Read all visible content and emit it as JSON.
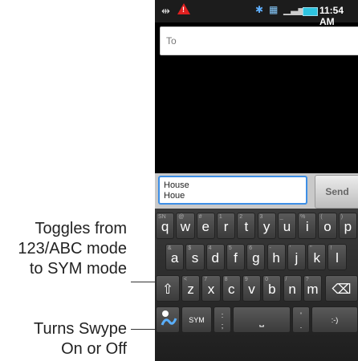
{
  "callouts": {
    "toggle_line1": "Toggles from",
    "toggle_line2": "123/ABC mode",
    "toggle_line3": "to SYM mode",
    "swype_line1": "Turns Swype",
    "swype_line2": "On or Off"
  },
  "status_bar": {
    "time": "11:54 AM",
    "left_icons": [
      "usb-icon",
      "alert-icon"
    ],
    "right_icons": [
      "bluetooth-icon",
      "data-icon",
      "signal-icon",
      "battery-icon"
    ]
  },
  "recipient": {
    "placeholder": "To"
  },
  "compose": {
    "line1": "House",
    "line2": "Houe",
    "send_label": "Send"
  },
  "keyboard": {
    "row1": [
      {
        "k": "q",
        "s": "SN"
      },
      {
        "k": "w",
        "s": "@"
      },
      {
        "k": "e",
        "s": "#"
      },
      {
        "k": "r",
        "s": "1"
      },
      {
        "k": "t",
        "s": "2"
      },
      {
        "k": "y",
        "s": "3"
      },
      {
        "k": "u",
        "s": "_"
      },
      {
        "k": "i",
        "s": "%"
      },
      {
        "k": "o",
        "s": "("
      },
      {
        "k": "p",
        "s": ")"
      }
    ],
    "row2": [
      {
        "k": "a",
        "s": "&"
      },
      {
        "k": "s",
        "s": "$"
      },
      {
        "k": "d",
        "s": "4"
      },
      {
        "k": "f",
        "s": "5"
      },
      {
        "k": "g",
        "s": "6"
      },
      {
        "k": "h",
        "s": "-"
      },
      {
        "k": "j",
        "s": "'"
      },
      {
        "k": "k",
        "s": "\""
      },
      {
        "k": "l",
        "s": "!"
      }
    ],
    "row3": [
      {
        "k": "z",
        "s": "<"
      },
      {
        "k": "x",
        "s": "7"
      },
      {
        "k": "c",
        "s": "8"
      },
      {
        "k": "v",
        "s": "9"
      },
      {
        "k": "b",
        "s": "0"
      },
      {
        "k": "n",
        "s": "/"
      },
      {
        "k": "m",
        "s": "?"
      }
    ],
    "shift_glyph": "⇧",
    "delete_glyph": "⌫",
    "sym_label": "SYM",
    "semicolon_top": ":",
    "semicolon_bottom": ";",
    "space_glyph": "⎵",
    "period_top": "'",
    "period_bottom": ".",
    "smiley": ":-)"
  }
}
